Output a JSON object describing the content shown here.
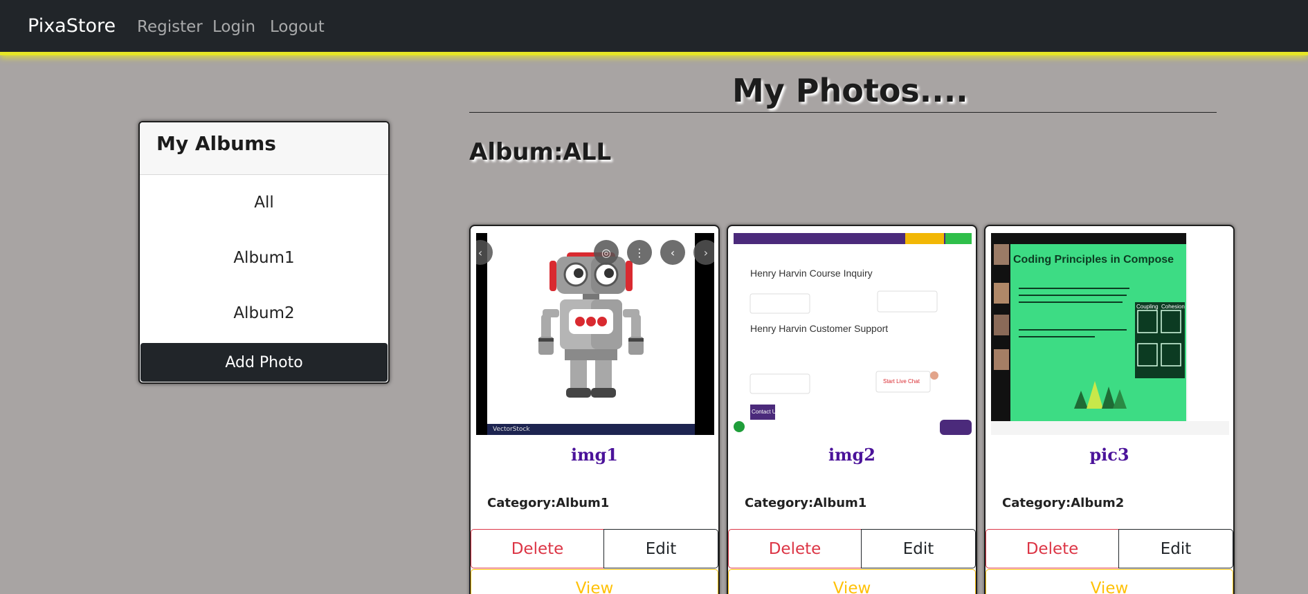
{
  "nav": {
    "brand": "PixaStore",
    "links": [
      "Register",
      "Login",
      "Logout"
    ]
  },
  "sidebar": {
    "title": "My Albums",
    "items": [
      "All",
      "Album1",
      "Album2"
    ],
    "add_button": "Add Photo"
  },
  "main": {
    "title": "My Photos....",
    "album_label": "Album:ALL"
  },
  "photos": [
    {
      "name": "img1",
      "category": "Category:Album1",
      "delete": "Delete",
      "edit": "Edit",
      "view": "View",
      "thumb_footer": "VectorStock"
    },
    {
      "name": "img2",
      "category": "Category:Album1",
      "delete": "Delete",
      "edit": "Edit",
      "view": "View",
      "thumb_texts": {
        "heading1": "Henry Harvin Course Inquiry",
        "heading2": "Henry Harvin Customer Support",
        "contact": "Contact Us",
        "chat": "Start Live Chat"
      }
    },
    {
      "name": "pic3",
      "category": "Category:Album2",
      "delete": "Delete",
      "edit": "Edit",
      "view": "View",
      "thumb_texts": {
        "slide_title": "Coding Principles in Compose",
        "col1": "Coupling",
        "col2": "Cohesion"
      }
    }
  ],
  "colors": {
    "navbar": "#212529",
    "navbar_glow": "#e6e627",
    "page_bg": "#a8a4a3",
    "photo_name": "#4b139a",
    "delete": "#dc3545",
    "view": "#ffc107"
  }
}
